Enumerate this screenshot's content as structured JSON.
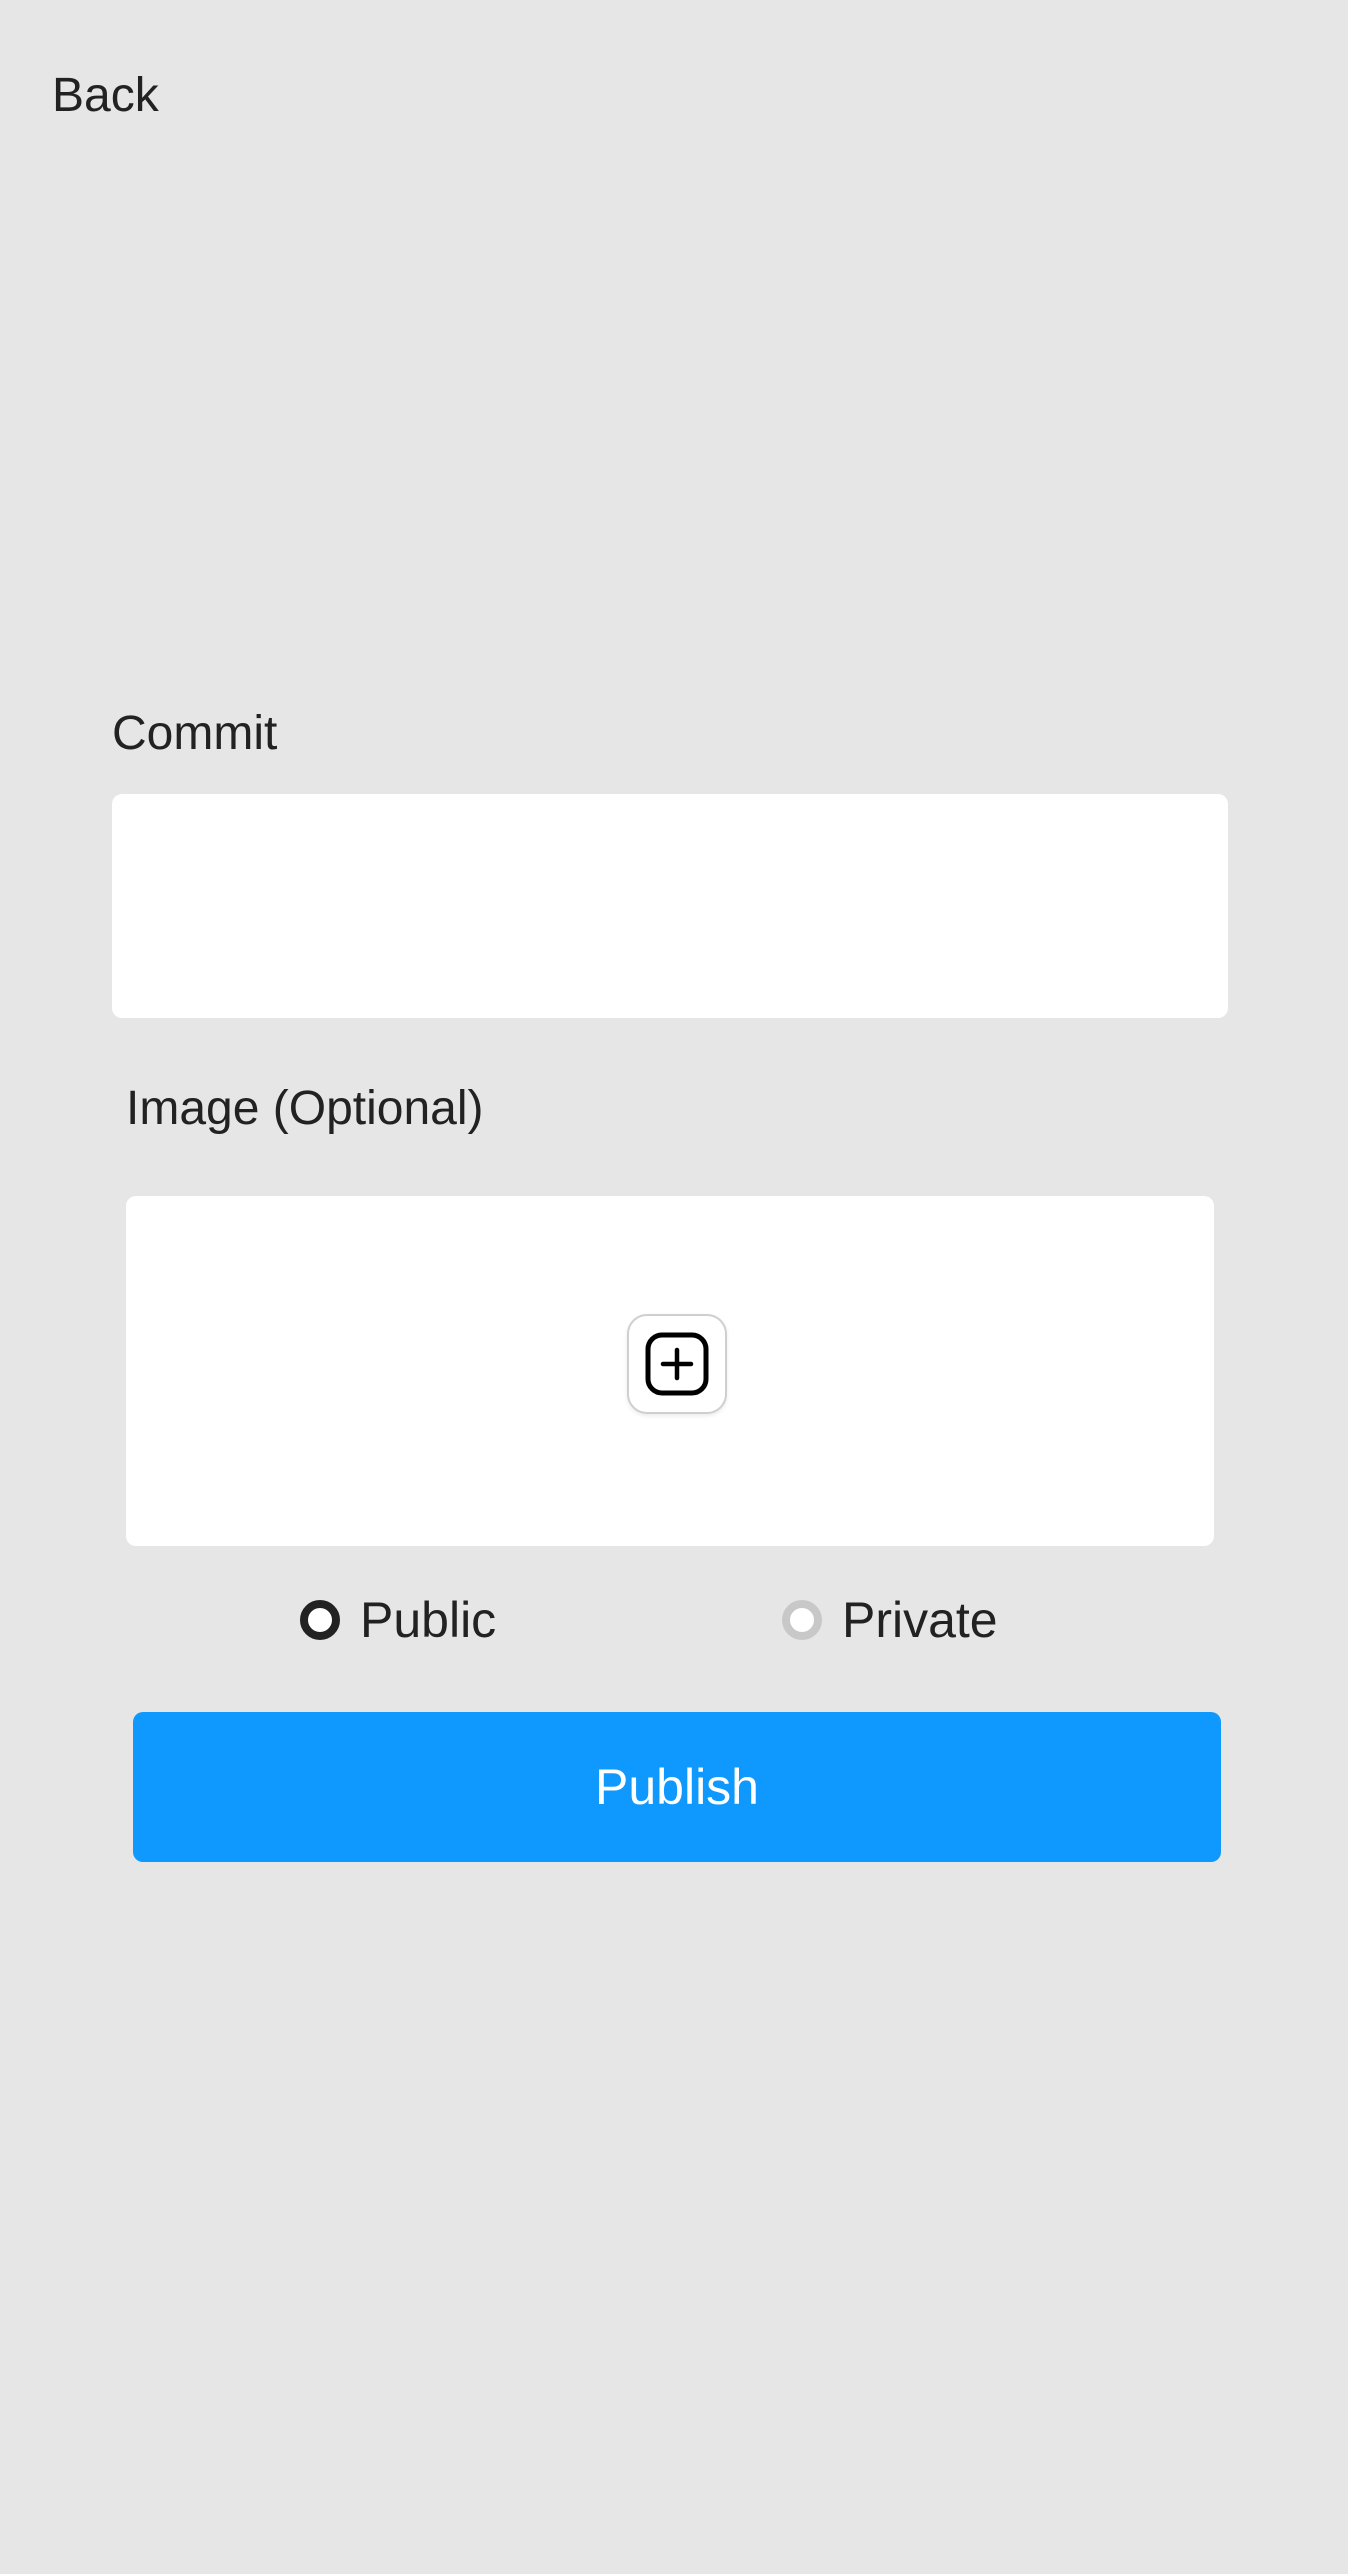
{
  "header": {
    "back_label": "Back"
  },
  "form": {
    "commit_label": "Commit",
    "commit_value": "",
    "commit_placeholder": "",
    "image_label": "Image (Optional)",
    "add_image_icon": "plus-square-icon",
    "visibility": {
      "options": [
        {
          "label": "Public",
          "selected": true
        },
        {
          "label": "Private",
          "selected": false
        }
      ]
    },
    "publish_label": "Publish"
  },
  "colors": {
    "background": "#e6e6e6",
    "accent": "#0f99fe",
    "text": "#222222",
    "radio_selected": "#222222",
    "radio_unselected": "#c8c8c8"
  }
}
